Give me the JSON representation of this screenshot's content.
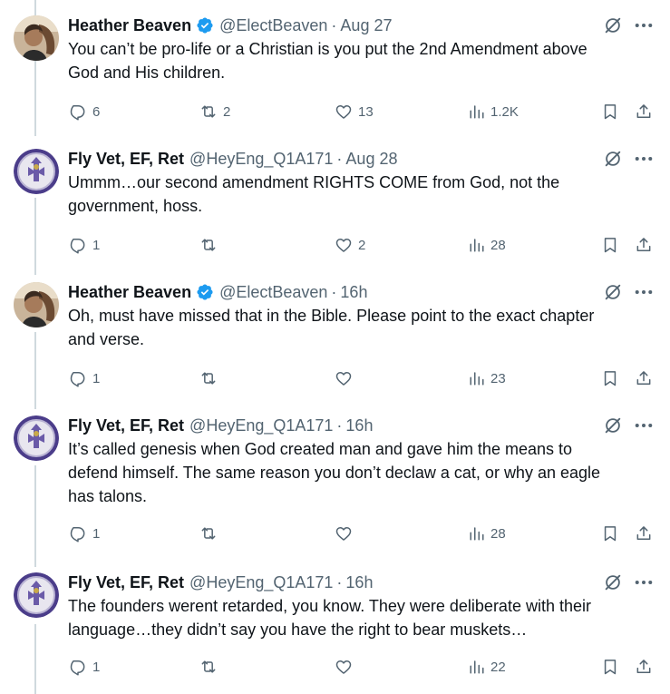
{
  "icons": {
    "verified": "verified-badge-icon",
    "grok": "grok-icon",
    "more": "more-dots-icon",
    "reply": "reply-icon",
    "retweet": "retweet-icon",
    "like": "like-icon",
    "views": "views-icon",
    "bookmark": "bookmark-icon",
    "share": "share-icon"
  },
  "colors": {
    "text": "#0f1419",
    "secondary": "#536471",
    "verified": "#1d9bf0",
    "thread_line": "#cfd9de"
  },
  "tweets": [
    {
      "name": "Heather Beaven",
      "verified": true,
      "handle": "@ElectBeaven",
      "dot": "·",
      "time": "Aug 27",
      "lines": [
        "You can’t be pro-life or a Christian is you put the 2nd Amendment above",
        "God and His children."
      ],
      "replies": "6",
      "retweets": "2",
      "likes": "13",
      "views": "1.2K"
    },
    {
      "name": "Fly Vet, EF, Ret",
      "verified": false,
      "handle": "@HeyEng_Q1A171",
      "dot": "·",
      "time": "Aug 28",
      "lines": [
        "Ummm…our second amendment RIGHTS COME from God, not the",
        "government, hoss."
      ],
      "replies": "1",
      "retweets": "",
      "likes": "2",
      "views": "28"
    },
    {
      "name": "Heather Beaven",
      "verified": true,
      "handle": "@ElectBeaven",
      "dot": "·",
      "time": "16h",
      "lines": [
        "Oh, must have missed that in the Bible. Please point to the exact chapter",
        "and verse."
      ],
      "replies": "1",
      "retweets": "",
      "likes": "",
      "views": "23"
    },
    {
      "name": "Fly Vet, EF, Ret",
      "verified": false,
      "handle": "@HeyEng_Q1A171",
      "dot": "·",
      "time": "16h",
      "lines": [
        "It’s called genesis when God created man and gave him the means to",
        "defend himself. The same reason you don’t declaw a cat, or why an eagle",
        "has talons."
      ],
      "replies": "1",
      "retweets": "",
      "likes": "",
      "views": "28"
    },
    {
      "name": "Fly Vet, EF, Ret",
      "verified": false,
      "handle": "@HeyEng_Q1A171",
      "dot": "·",
      "time": "16h",
      "lines": [
        "The founders werent retarded, you know. They were deliberate with their",
        "language…they didn’t say you have the right to bear muskets…"
      ],
      "replies": "1",
      "retweets": "",
      "likes": "",
      "views": "22"
    }
  ]
}
